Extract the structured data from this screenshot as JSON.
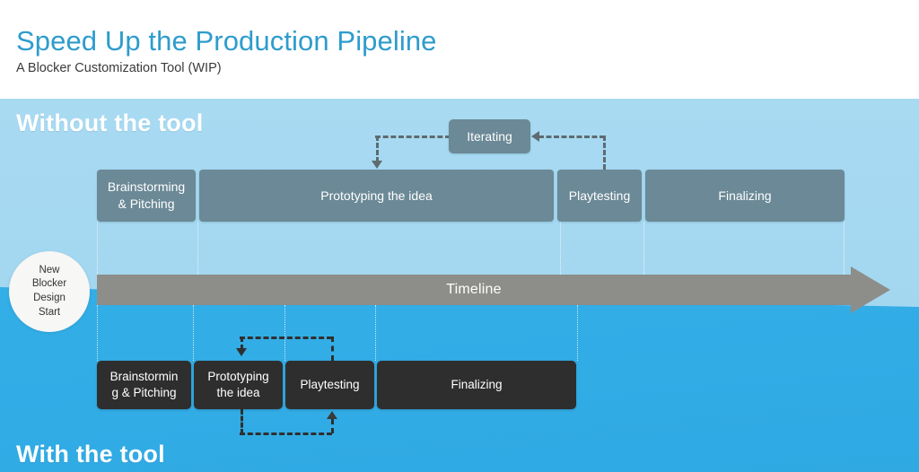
{
  "header": {
    "title": "Speed Up the Production Pipeline",
    "subtitle": "A Blocker Customization Tool (WIP)",
    "title_color": "#2e9ccc"
  },
  "sections": {
    "without_label": "Without the tool",
    "with_label": "With the tool"
  },
  "timeline": {
    "label": "Timeline",
    "color": "#8d8d8a"
  },
  "start_marker": {
    "lines": [
      "New",
      "Blocker",
      "Design",
      "Start"
    ],
    "text": "New Blocker Design Start"
  },
  "without_tool": {
    "feedback_box": {
      "label": "Iterating"
    },
    "phases": [
      {
        "label": "Brainstorming & Pitching",
        "line1": "Brainstorming",
        "line2": "& Pitching"
      },
      {
        "label": "Prototyping the idea",
        "line1": "Prototyping the idea",
        "line2": ""
      },
      {
        "label": "Playtesting",
        "line1": "Playtesting",
        "line2": ""
      },
      {
        "label": "Finalizing",
        "line1": "Finalizing",
        "line2": ""
      }
    ],
    "box_color": "#6b8996"
  },
  "with_tool": {
    "phases": [
      {
        "label": "Brainstorming & Pitching",
        "line1": "Brainstormin",
        "line2": "g & Pitching"
      },
      {
        "label": "Prototyping the idea",
        "line1": "Prototyping",
        "line2": "the idea"
      },
      {
        "label": "Playtesting",
        "line1": "Playtesting",
        "line2": ""
      },
      {
        "label": "Finalizing",
        "line1": "Finalizing",
        "line2": ""
      }
    ],
    "box_color": "#2e2e2e"
  },
  "background": {
    "top_color": "#a8daf2",
    "bottom_color": "#33aee7"
  }
}
